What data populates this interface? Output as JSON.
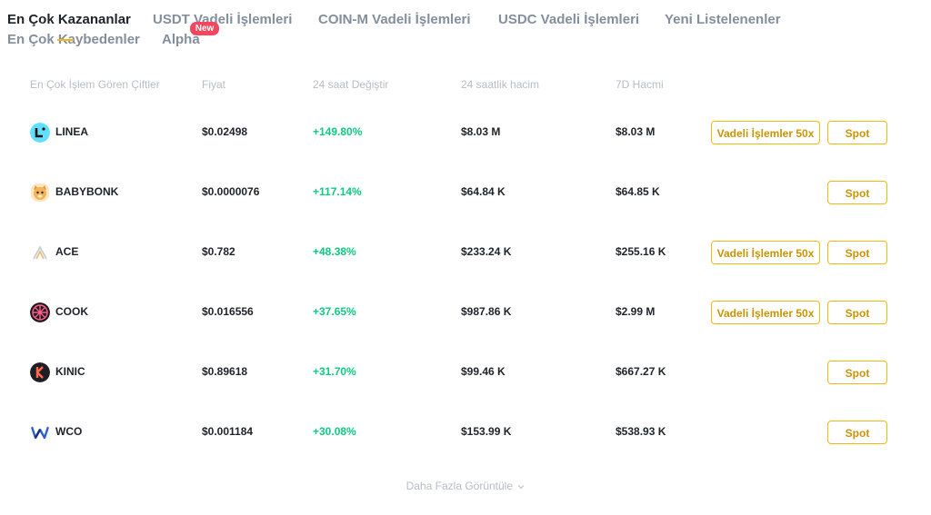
{
  "tabs": [
    {
      "label": "En Çok Kazananlar",
      "active": true
    },
    {
      "label": "USDT Vadeli İşlemleri"
    },
    {
      "label": "COIN-M Vadeli İşlemleri"
    },
    {
      "label": "USDC Vadeli İşlemleri"
    },
    {
      "label": "Yeni Listelenenler"
    },
    {
      "label": "En Çok Kaybedenler"
    },
    {
      "label": "Alpha"
    }
  ],
  "new_badge": "New",
  "columns": {
    "pair": "En Çok İşlem Gören Çiftler",
    "price": "Fiyat",
    "change": "24 saat Değiştir",
    "volume24h": "24 saatlik hacim",
    "volume7d": "7D Hacmi"
  },
  "rows": [
    {
      "coin": "LINEA",
      "price": "$0.02498",
      "change": "+149.80%",
      "volume24h": "$8.03 M",
      "volume7d": "$8.03 M",
      "futures": "Vadeli İşlemler 50x",
      "spot": "Spot"
    },
    {
      "coin": "BABYBONK",
      "price": "$0.0000076",
      "change": "+117.14%",
      "volume24h": "$64.84 K",
      "volume7d": "$64.85 K",
      "spot": "Spot"
    },
    {
      "coin": "ACE",
      "price": "$0.782",
      "change": "+48.38%",
      "volume24h": "$233.24 K",
      "volume7d": "$255.16 K",
      "futures": "Vadeli İşlemler 50x",
      "spot": "Spot"
    },
    {
      "coin": "COOK",
      "price": "$0.016556",
      "change": "+37.65%",
      "volume24h": "$987.86 K",
      "volume7d": "$2.99 M",
      "futures": "Vadeli İşlemler 50x",
      "spot": "Spot"
    },
    {
      "coin": "KINIC",
      "price": "$0.89618",
      "change": "+31.70%",
      "volume24h": "$99.46 K",
      "volume7d": "$667.27 K",
      "spot": "Spot"
    },
    {
      "coin": "WCO",
      "price": "$0.001184",
      "change": "+30.08%",
      "volume24h": "$153.99 K",
      "volume7d": "$538.93 K",
      "spot": "Spot"
    }
  ],
  "show_more": "Daha Fazla Görüntüle",
  "colors": {
    "positive": "#0ecb81",
    "accent": "#f0b90b",
    "badge": "#f6465d"
  },
  "icons": [
    "linea-icon",
    "babybonk-icon",
    "ace-icon",
    "cook-icon",
    "kinic-icon",
    "wco-icon",
    "chevron-down-icon"
  ]
}
